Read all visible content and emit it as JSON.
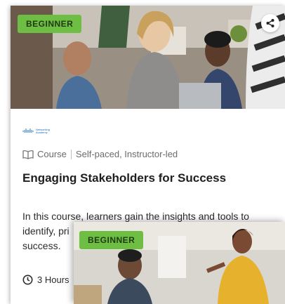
{
  "card": {
    "badge": "BEGINNER",
    "share_icon": "share-icon",
    "logo": {
      "name": "cisco-networking-academy-logo",
      "wordmark": "CISCO",
      "line1": "Networking",
      "line2": "Academy"
    },
    "type_icon": "book-icon",
    "type_label": "Course",
    "delivery": "Self-paced, Instructor-led",
    "title": "Engaging Stakeholders for Success",
    "description": "In this course, learners gain the insights and tools to identify, pri",
    "description_line3": "success.",
    "duration_icon": "clock-icon",
    "duration": "3 Hours"
  },
  "overlay_card": {
    "badge": "BEGINNER"
  },
  "colors": {
    "badge_green": "#6fbe44",
    "title_text": "#1f1f1f",
    "meta_text": "#6b6b6b"
  }
}
